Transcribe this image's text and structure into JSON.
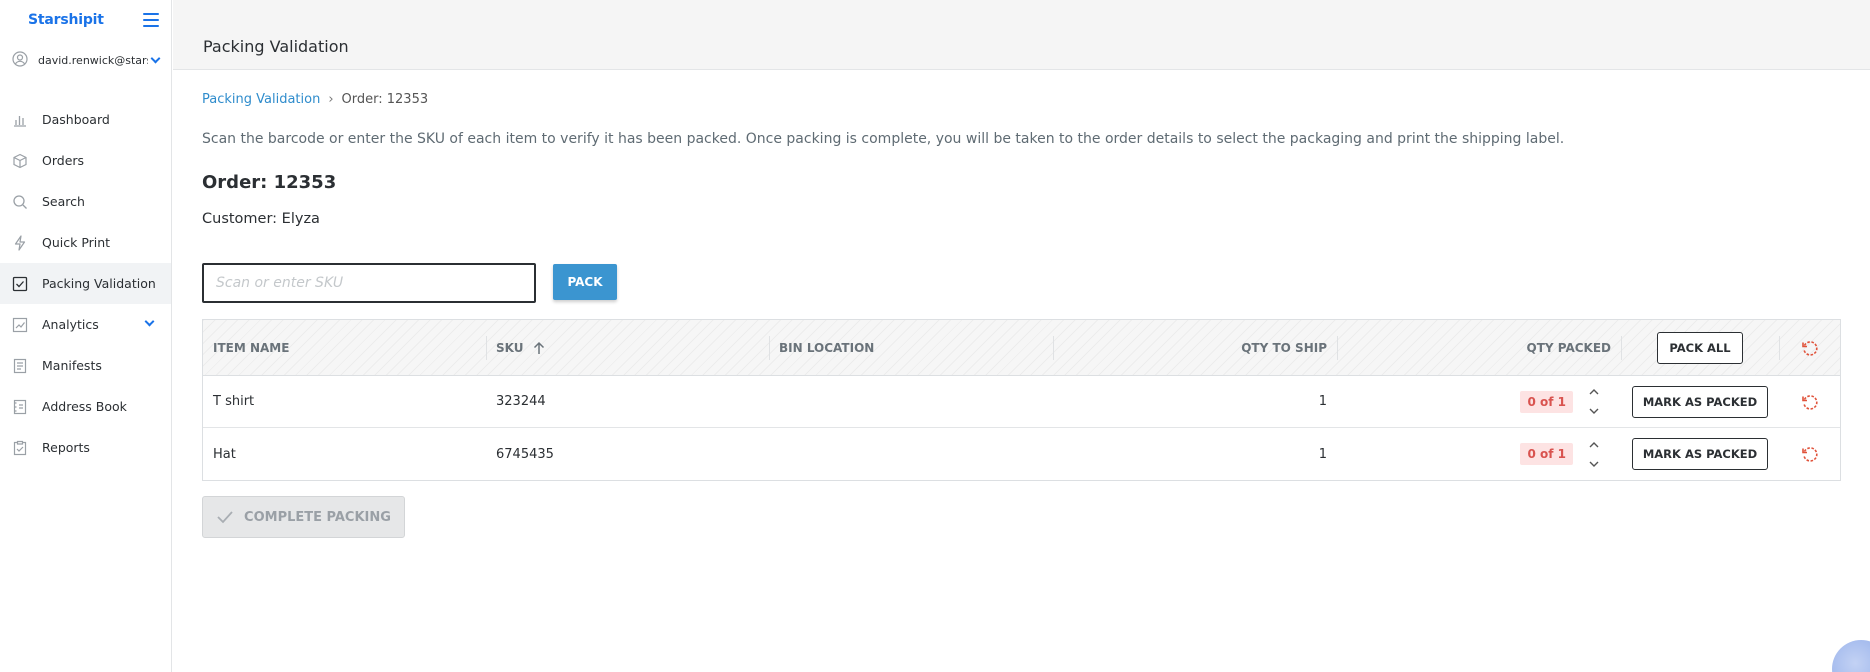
{
  "sidebar": {
    "logo": "Starshipit",
    "user_email": "david.renwick@starshipit.com",
    "items": [
      {
        "label": "Dashboard",
        "icon": "bar-chart-icon"
      },
      {
        "label": "Orders",
        "icon": "box-icon"
      },
      {
        "label": "Search",
        "icon": "search-icon"
      },
      {
        "label": "Quick Print",
        "icon": "lightning-icon"
      },
      {
        "label": "Packing Validation",
        "icon": "checkbox-icon",
        "active": true
      },
      {
        "label": "Analytics",
        "icon": "analytics-icon",
        "expandable": true
      },
      {
        "label": "Manifests",
        "icon": "manifest-icon"
      },
      {
        "label": "Address Book",
        "icon": "address-book-icon"
      },
      {
        "label": "Reports",
        "icon": "report-icon"
      }
    ]
  },
  "header": {
    "title": "Packing Validation"
  },
  "breadcrumb": {
    "link": "Packing Validation",
    "separator": "›",
    "current": "Order: 12353"
  },
  "description": "Scan the barcode or enter the SKU of each item to verify it has been packed. Once packing is complete, you will be taken to the order details to select the packaging and print the shipping label.",
  "order": {
    "title": "Order: 12353",
    "customer": "Customer: Elyza"
  },
  "scan": {
    "placeholder": "Scan or enter SKU",
    "value": "",
    "button": "PACK"
  },
  "table": {
    "columns": {
      "item_name": "ITEM NAME",
      "sku": "SKU",
      "bin_location": "BIN LOCATION",
      "qty_to_ship": "QTY TO SHIP",
      "qty_packed": "QTY PACKED"
    },
    "pack_all": "PACK ALL",
    "rows": [
      {
        "name": "T shirt",
        "sku": "323244",
        "bin": "",
        "qty_to_ship": "1",
        "qty_packed": "0 of 1",
        "action": "MARK AS PACKED"
      },
      {
        "name": "Hat",
        "sku": "6745435",
        "bin": "",
        "qty_to_ship": "1",
        "qty_packed": "0 of 1",
        "action": "MARK AS PACKED"
      }
    ]
  },
  "complete_button": "COMPLETE PACKING",
  "colors": {
    "brand": "#1a73e8",
    "link": "#2f8ccc",
    "pack_button": "#3b95d0",
    "badge_bg": "#fde3e3",
    "badge_text": "#d9534f",
    "reset_icon": "#e0533b"
  }
}
